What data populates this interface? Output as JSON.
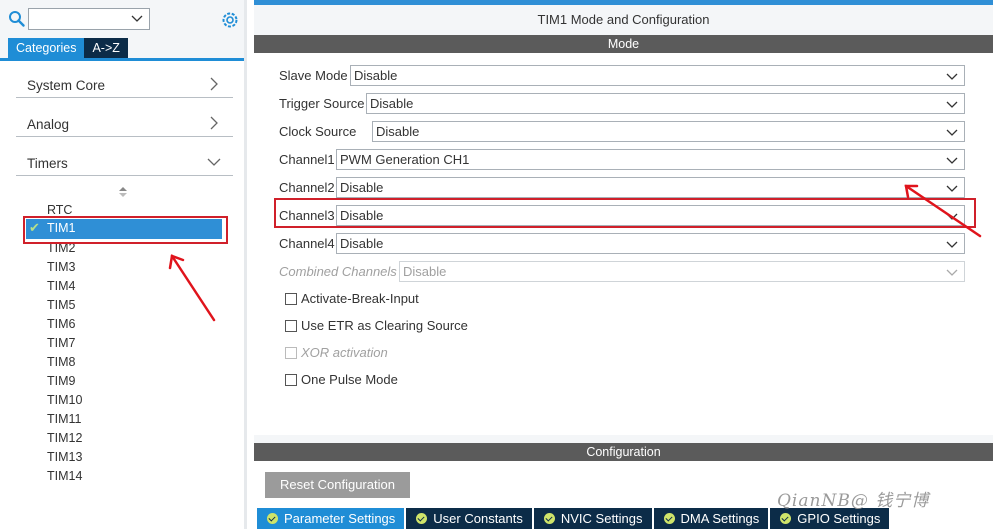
{
  "left": {
    "search_value": "",
    "tabs": [
      {
        "label": "Categories",
        "active": true
      },
      {
        "label": "A->Z",
        "active": false
      }
    ],
    "categories": [
      {
        "label": "System Core",
        "arrow": "chevron-right"
      },
      {
        "label": "Analog",
        "arrow": "chevron-right"
      },
      {
        "label": "Timers",
        "arrow": "chevron-down"
      }
    ],
    "timers": [
      "RTC",
      "TIM1",
      "TIM2",
      "TIM3",
      "TIM4",
      "TIM5",
      "TIM6",
      "TIM7",
      "TIM8",
      "TIM9",
      "TIM10",
      "TIM11",
      "TIM12",
      "TIM13",
      "TIM14"
    ],
    "selected_timer": "TIM1"
  },
  "right": {
    "title": "TIM1 Mode and Configuration",
    "mode_header": "Mode",
    "config_header": "Configuration",
    "fields": [
      {
        "label": "Slave Mode",
        "value": "Disable",
        "enabled": true
      },
      {
        "label": "Trigger Source",
        "value": "Disable",
        "enabled": true
      },
      {
        "label": "Clock Source",
        "value": "Disable",
        "enabled": true
      },
      {
        "label": "Channel1",
        "value": "PWM Generation CH1",
        "enabled": true
      },
      {
        "label": "Channel2",
        "value": "Disable",
        "enabled": true
      },
      {
        "label": "Channel3",
        "value": "Disable",
        "enabled": true
      },
      {
        "label": "Channel4",
        "value": "Disable",
        "enabled": true
      },
      {
        "label": "Combined Channels",
        "value": "Disable",
        "enabled": false
      }
    ],
    "checkboxes": [
      {
        "label": "Activate-Break-Input",
        "checked": false,
        "enabled": true
      },
      {
        "label": "Use ETR as Clearing Source",
        "checked": false,
        "enabled": true
      },
      {
        "label": "XOR activation",
        "checked": false,
        "enabled": false
      },
      {
        "label": "One Pulse Mode",
        "checked": false,
        "enabled": true
      }
    ],
    "reset_button": "Reset Configuration",
    "config_tabs": [
      {
        "label": "Parameter Settings",
        "active": true
      },
      {
        "label": "User Constants",
        "active": false
      },
      {
        "label": "NVIC Settings",
        "active": false
      },
      {
        "label": "DMA Settings",
        "active": false
      },
      {
        "label": "GPIO Settings",
        "active": false
      }
    ]
  },
  "watermark": "QianNB@ 钱宁博",
  "colors": {
    "accent": "#1f8dd6",
    "tab_dark": "#0c2c48",
    "header_bar": "#5b5b5b",
    "highlight_box": "#d0202a",
    "check_ok": "#cfe46a"
  }
}
